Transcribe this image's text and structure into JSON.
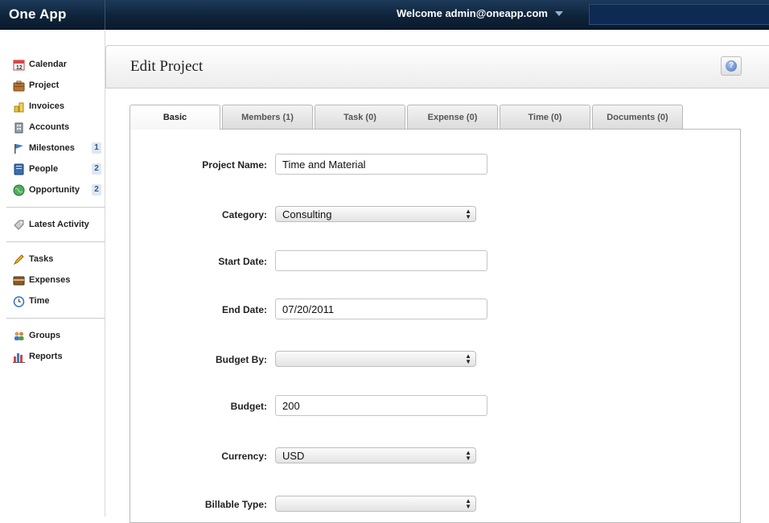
{
  "app": {
    "name": "One App",
    "welcome": "Welcome admin@oneapp.com"
  },
  "sidebar": {
    "groups": [
      [
        {
          "label": "Calendar",
          "icon": "calendar-icon",
          "badge": null
        },
        {
          "label": "Project",
          "icon": "briefcase-icon",
          "badge": null
        },
        {
          "label": "Invoices",
          "icon": "coins-icon",
          "badge": null
        },
        {
          "label": "Accounts",
          "icon": "building-icon",
          "badge": null
        },
        {
          "label": "Milestones",
          "icon": "flag-icon",
          "badge": "1"
        },
        {
          "label": "People",
          "icon": "address-book-icon",
          "badge": "2"
        },
        {
          "label": "Opportunity",
          "icon": "globe-icon",
          "badge": "2"
        }
      ],
      [
        {
          "label": "Latest Activity",
          "icon": "tag-icon",
          "badge": null
        }
      ],
      [
        {
          "label": "Tasks",
          "icon": "pencil-icon",
          "badge": null
        },
        {
          "label": "Expenses",
          "icon": "wallet-icon",
          "badge": null
        },
        {
          "label": "Time",
          "icon": "clock-icon",
          "badge": null
        }
      ],
      [
        {
          "label": "Groups",
          "icon": "users-icon",
          "badge": null
        },
        {
          "label": "Reports",
          "icon": "bar-chart-icon",
          "badge": null
        }
      ]
    ]
  },
  "page": {
    "title": "Edit Project",
    "help_icon": "help-icon"
  },
  "tabs": [
    {
      "label": "Basic",
      "active": true
    },
    {
      "label": "Members (1)",
      "active": false
    },
    {
      "label": "Task (0)",
      "active": false
    },
    {
      "label": "Expense (0)",
      "active": false
    },
    {
      "label": "Time (0)",
      "active": false
    },
    {
      "label": "Documents (0)",
      "active": false
    }
  ],
  "form": {
    "project_name": {
      "label": "Project Name:",
      "value": "Time and Material"
    },
    "category": {
      "label": "Category:",
      "value": "Consulting"
    },
    "start_date": {
      "label": "Start Date:",
      "value": ""
    },
    "end_date": {
      "label": "End Date:",
      "value": "07/20/2011"
    },
    "budget_by": {
      "label": "Budget By:",
      "value": ""
    },
    "budget": {
      "label": "Budget:",
      "value": "200"
    },
    "currency": {
      "label": "Currency:",
      "value": "USD"
    },
    "billable_type": {
      "label": "Billable Type:",
      "value": ""
    }
  },
  "colors": {
    "topbar": "#0e2238",
    "badge_bg": "#dde8f3"
  }
}
